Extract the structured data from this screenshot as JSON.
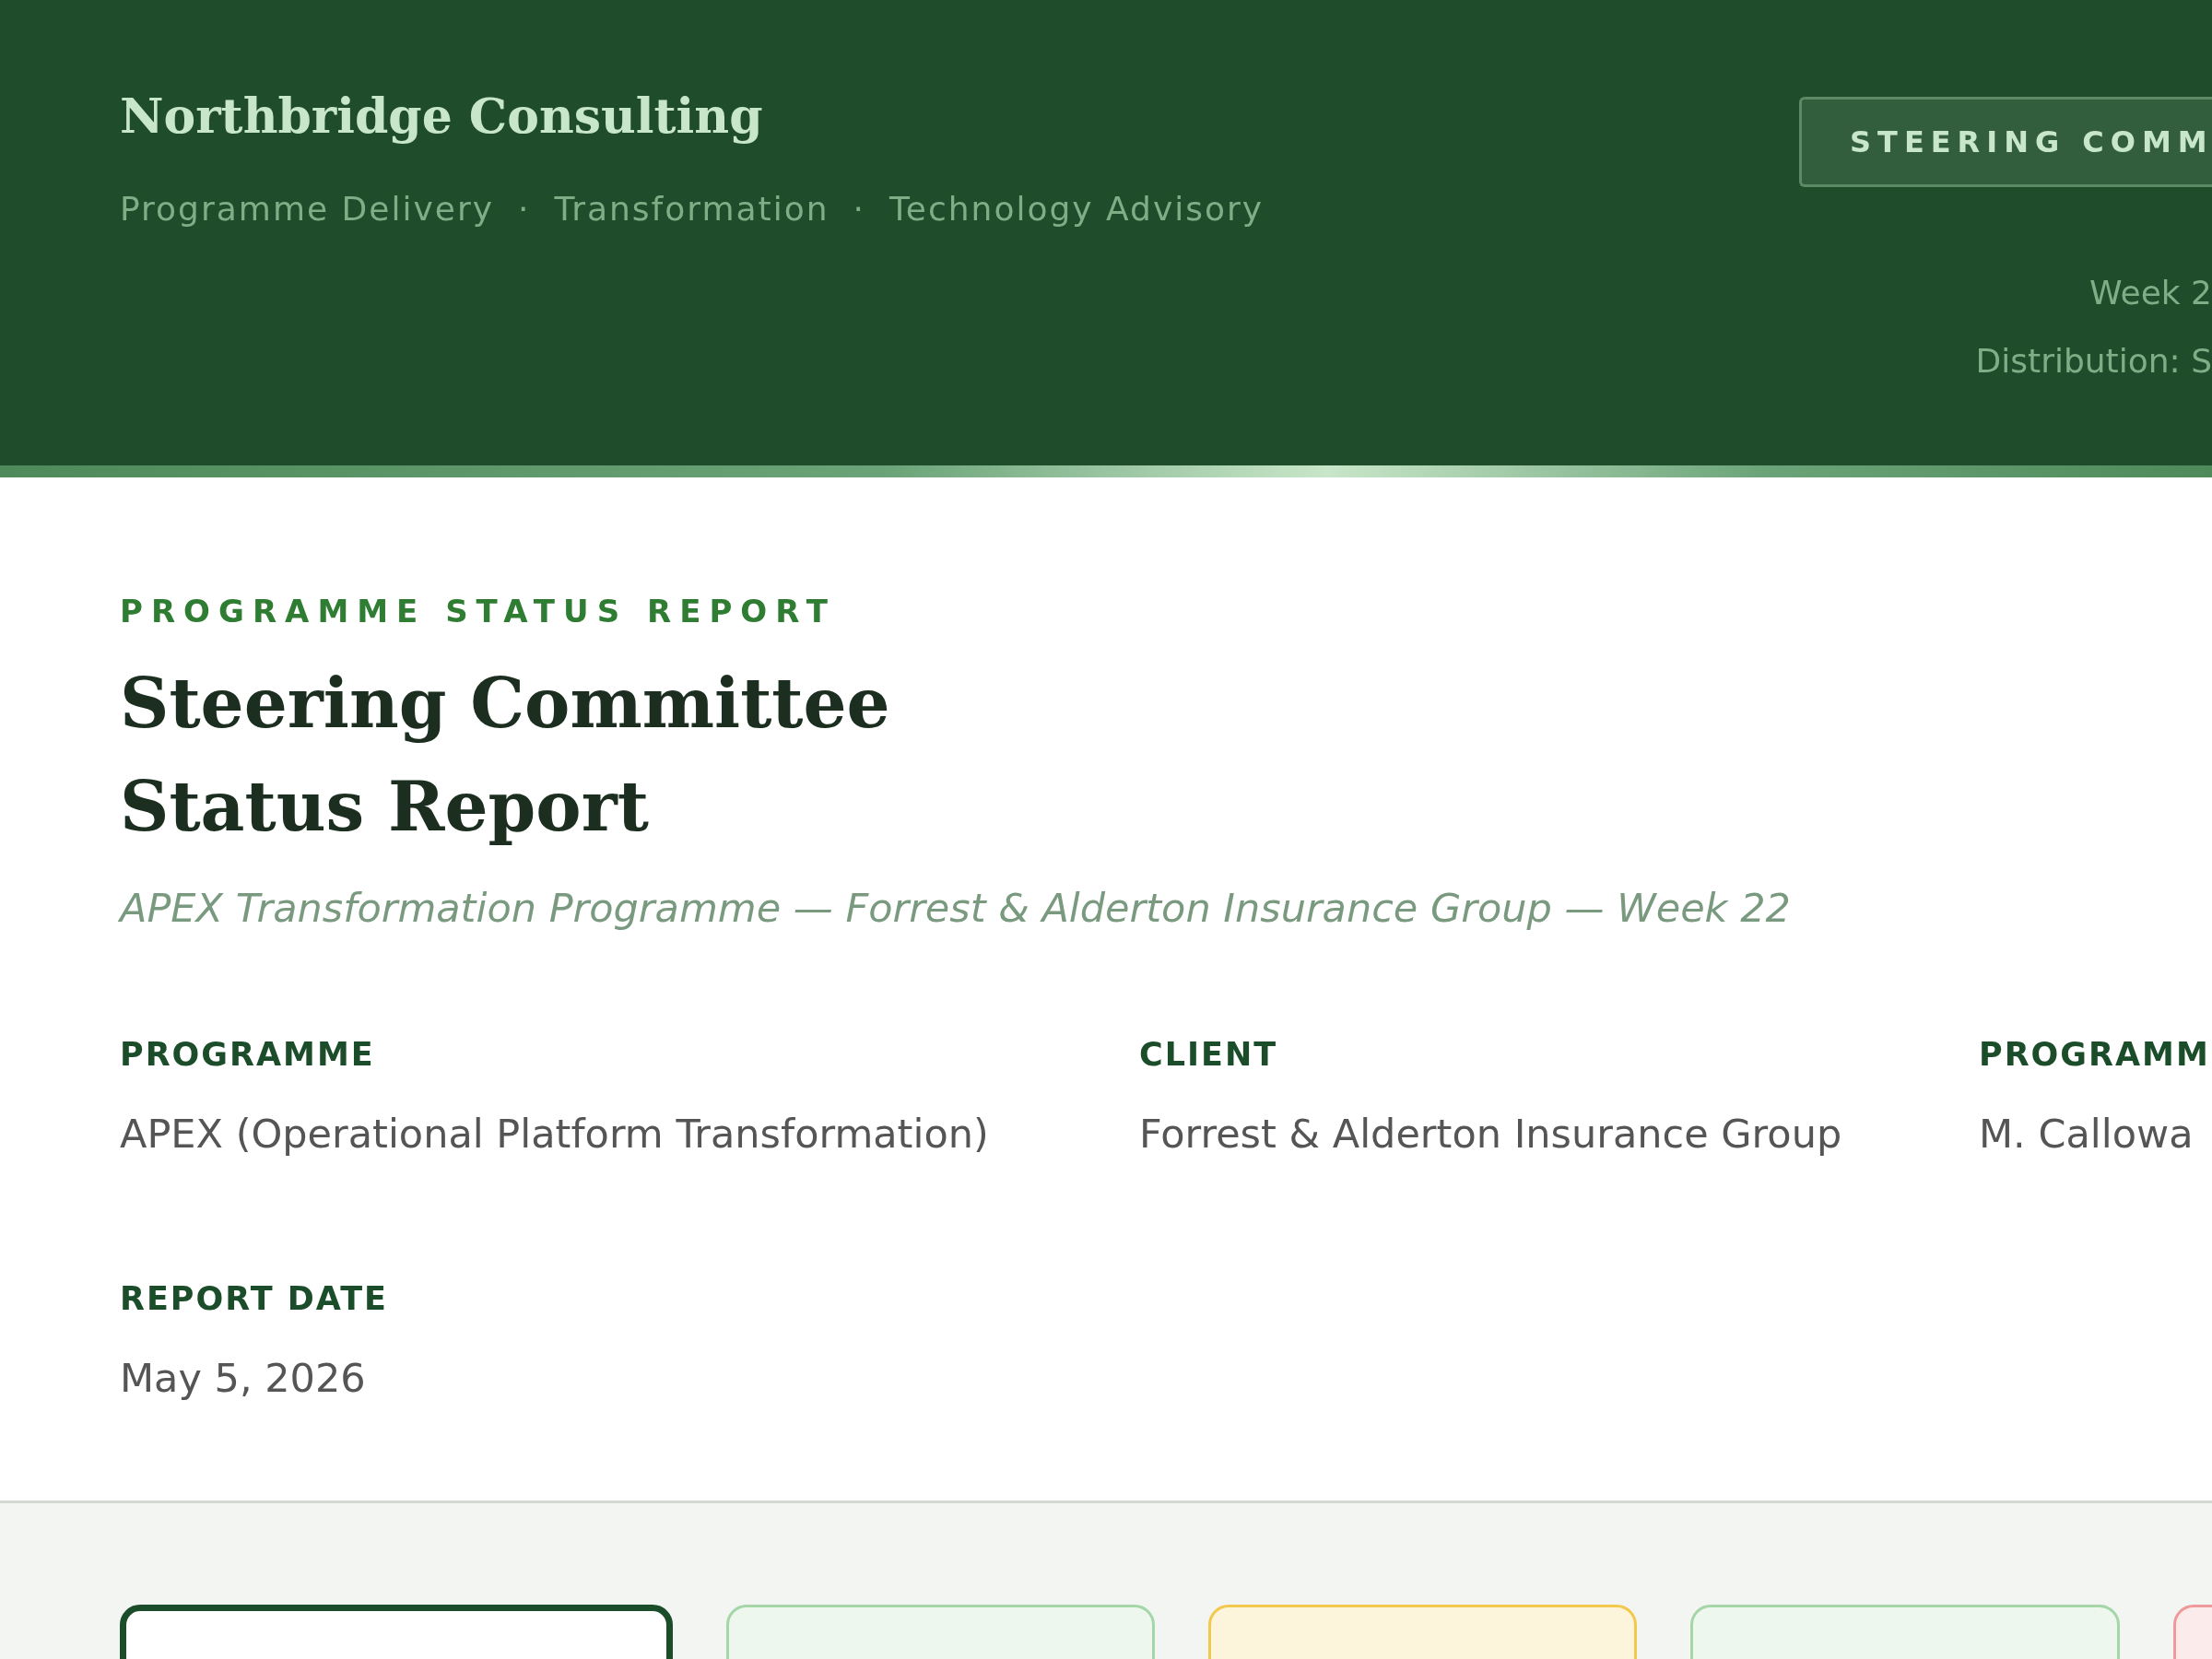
{
  "header": {
    "brand": "Northbridge Consulting",
    "services": [
      "Programme Delivery",
      "Transformation",
      "Technology Advisory"
    ],
    "separator": "·",
    "badge": "STEERING COMM",
    "week": "Week 2",
    "distribution": "Distribution: S"
  },
  "report": {
    "eyebrow": "PROGRAMME STATUS REPORT",
    "title_lines": [
      "Steering Committee",
      "Status Report"
    ],
    "subtitle": "APEX Transformation Programme — Forrest & Alderton Insurance Group — Week 22"
  },
  "meta": [
    {
      "label": "PROGRAMME",
      "value": "APEX (Operational Platform Transformation)"
    },
    {
      "label": "CLIENT",
      "value": "Forrest & Alderton Insurance Group"
    },
    {
      "label": "PROGRAMM",
      "value": "M. Callowa"
    },
    {
      "label": "REPORT DATE",
      "value": "May 5, 2026"
    }
  ],
  "cards": [
    {
      "selected": true,
      "color": "#1b4d2a"
    },
    {
      "selected": false,
      "color": "#a5d6a7"
    },
    {
      "selected": false,
      "color": "#f2c94c"
    },
    {
      "selected": false,
      "color": "#a5d6a7"
    },
    {
      "selected": false,
      "color": "#ef9a9a"
    }
  ]
}
